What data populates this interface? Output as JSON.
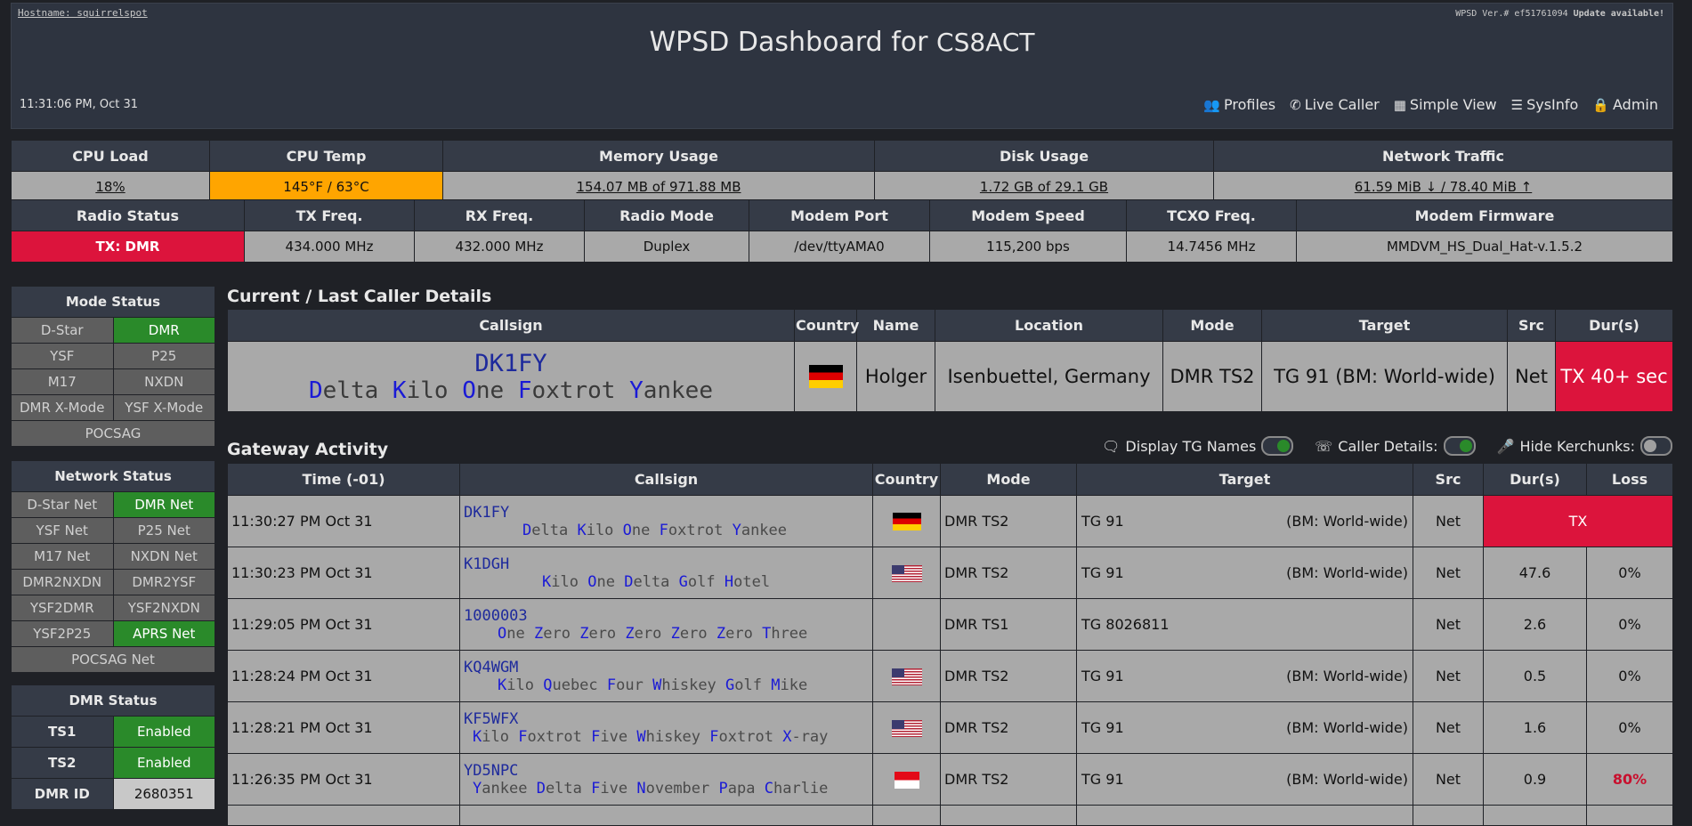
{
  "header": {
    "hostname": "Hostname: squirrelspot",
    "version_prefix": "WPSD Ver.# ef51761094 ",
    "update": "Update available!",
    "title": "WPSD Dashboard for ",
    "callsign": "CS8ACT",
    "clock": "11:31:06 PM, Oct 31"
  },
  "nav": {
    "profiles": "Profiles",
    "live_caller": "Live Caller",
    "simple_view": "Simple View",
    "sysinfo": "SysInfo",
    "admin": "Admin"
  },
  "system": {
    "headers": [
      "CPU Load",
      "CPU Temp",
      "Memory Usage",
      "Disk Usage",
      "Network Traffic"
    ],
    "cpu_load": "18%",
    "cpu_temp": "145°F / 63°C",
    "memory": "154.07 MB of 971.88 MB",
    "disk": "1.72 GB of 29.1 GB",
    "network": "61.59 MiB ↓ / 78.40 MiB ↑"
  },
  "radio": {
    "headers": [
      "Radio Status",
      "TX Freq.",
      "RX Freq.",
      "Radio Mode",
      "Modem Port",
      "Modem Speed",
      "TCXO Freq.",
      "Modem Firmware"
    ],
    "status": "TX: DMR",
    "tx_freq": "434.000 MHz",
    "rx_freq": "432.000 MHz",
    "mode": "Duplex",
    "port": "/dev/ttyAMA0",
    "speed": "115,200 bps",
    "tcxo": "14.7456 MHz",
    "firmware": "MMDVM_HS_Dual_Hat-v.1.5.2"
  },
  "mode_status": {
    "title": "Mode Status",
    "items": [
      "D-Star",
      "DMR",
      "YSF",
      "P25",
      "M17",
      "NXDN",
      "DMR X-Mode",
      "YSF X-Mode",
      "POCSAG"
    ]
  },
  "network_status": {
    "title": "Network Status",
    "items": [
      "D-Star Net",
      "DMR Net",
      "YSF Net",
      "P25 Net",
      "M17 Net",
      "NXDN Net",
      "DMR2NXDN",
      "DMR2YSF",
      "YSF2DMR",
      "YSF2NXDN",
      "YSF2P25",
      "APRS Net",
      "POCSAG Net"
    ]
  },
  "dmr_status": {
    "title": "DMR Status",
    "ts1_label": "TS1",
    "ts1": "Enabled",
    "ts2_label": "TS2",
    "ts2": "Enabled",
    "id_label": "DMR ID",
    "id": "2680351"
  },
  "caller": {
    "section_title": "Current / Last Caller Details",
    "headers": [
      "Callsign",
      "Country",
      "Name",
      "Location",
      "Mode",
      "Target",
      "Src",
      "Dur(s)"
    ],
    "callsign": "DK1FY",
    "phonetic": [
      "Delta",
      "Kilo",
      "One",
      "Foxtrot",
      "Yankee"
    ],
    "flag": "germany-flag",
    "name": "Holger",
    "location": "Isenbuettel, Germany",
    "mode": "DMR TS2",
    "target": "TG 91 (BM: World-wide)",
    "src": "Net",
    "dur": "TX 40+ sec"
  },
  "gateway": {
    "section_title": "Gateway Activity",
    "toggles": {
      "tg_names": "Display TG Names",
      "caller_details": "Caller Details:",
      "hide_kerchunks": "Hide Kerchunks:"
    },
    "headers": [
      "Time (-01)",
      "Callsign",
      "Country",
      "Mode",
      "Target",
      "Src",
      "Dur(s)",
      "Loss"
    ],
    "rows": [
      {
        "time": "11:30:27 PM Oct 31",
        "call": "DK1FY",
        "phon": [
          "Delta",
          "Kilo",
          "One",
          "Foxtrot",
          "Yankee"
        ],
        "flag": "germany-flag",
        "mode": "DMR TS2",
        "tg": "TG 91",
        "tgname": "(BM: World-wide)",
        "src": "Net",
        "dur": "TX",
        "loss": ""
      },
      {
        "time": "11:30:23 PM Oct 31",
        "call": "K1DGH",
        "phon": [
          "Kilo",
          "One",
          "Delta",
          "Golf",
          "Hotel"
        ],
        "flag": "usa-flag",
        "mode": "DMR TS2",
        "tg": "TG 91",
        "tgname": "(BM: World-wide)",
        "src": "Net",
        "dur": "47.6",
        "loss": "0%"
      },
      {
        "time": "11:29:05 PM Oct 31",
        "call": "1000003",
        "phon": [
          "One",
          "Zero",
          "Zero",
          "Zero",
          "Zero",
          "Zero",
          "Three"
        ],
        "flag": "",
        "mode": "DMR TS1",
        "tg": "TG 8026811",
        "tgname": "",
        "src": "Net",
        "dur": "2.6",
        "loss": "0%"
      },
      {
        "time": "11:28:24 PM Oct 31",
        "call": "KQ4WGM",
        "phon": [
          "Kilo",
          "Quebec",
          "Four",
          "Whiskey",
          "Golf",
          "Mike"
        ],
        "flag": "usa-flag",
        "mode": "DMR TS2",
        "tg": "TG 91",
        "tgname": "(BM: World-wide)",
        "src": "Net",
        "dur": "0.5",
        "loss": "0%"
      },
      {
        "time": "11:28:21 PM Oct 31",
        "call": "KF5WFX",
        "phon": [
          "Kilo",
          "Foxtrot",
          "Five",
          "Whiskey",
          "Foxtrot",
          "X-ray"
        ],
        "flag": "usa-flag",
        "mode": "DMR TS2",
        "tg": "TG 91",
        "tgname": "(BM: World-wide)",
        "src": "Net",
        "dur": "1.6",
        "loss": "0%"
      },
      {
        "time": "11:26:35 PM Oct 31",
        "call": "YD5NPC",
        "phon": [
          "Yankee",
          "Delta",
          "Five",
          "November",
          "Papa",
          "Charlie"
        ],
        "flag": "indonesia-flag",
        "mode": "DMR TS2",
        "tg": "TG 91",
        "tgname": "(BM: World-wide)",
        "src": "Net",
        "dur": "0.9",
        "loss": "80%"
      }
    ]
  }
}
